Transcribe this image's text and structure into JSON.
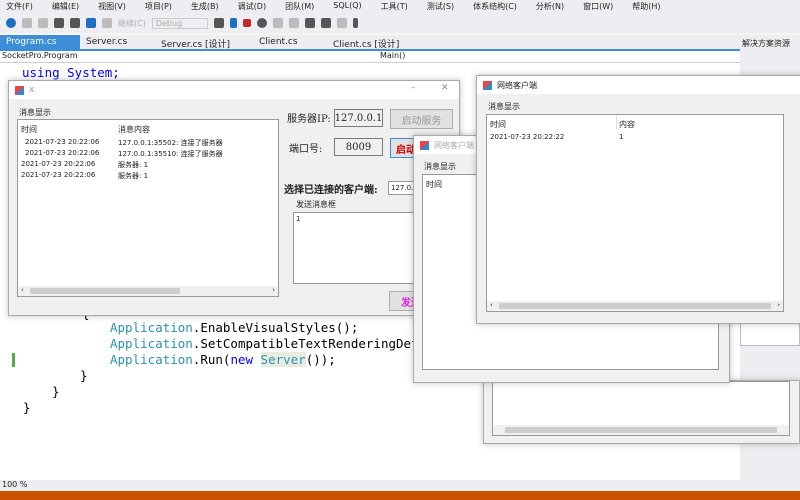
{
  "menu": [
    "文件(F)",
    "编辑(E)",
    "视图(V)",
    "项目(P)",
    "生成(B)",
    "调试(D)",
    "团队(M)",
    "SQL(Q)",
    "工具(T)",
    "测试(S)",
    "体系结构(C)",
    "分析(N)",
    "窗口(W)",
    "帮助(H)"
  ],
  "toolbar": {
    "continue": "继续(C)",
    "config": "Debug"
  },
  "tabs": [
    "Program.cs",
    "Server.cs",
    "Server.cs [设计]",
    "Client.cs",
    "Client.cs [设计]"
  ],
  "nav": {
    "left": "SocketPro.Program",
    "right": "Main()"
  },
  "side": {
    "title": "解决方案资源"
  },
  "code": {
    "l1": "using System;",
    "l2": "{",
    "l3a": "Application",
    "l3b": ".EnableVisualStyles();",
    "l4b": ".SetCompatibleTextRenderingDefa",
    "l5b": ".Run(",
    "l5new": "new",
    "l5srv": "Server",
    "l5end": "());",
    "close": "}"
  },
  "status": {
    "zoom": "100 %"
  },
  "server": {
    "title": "x",
    "group": "消息显示",
    "columns": [
      "时间",
      "消息内容"
    ],
    "rows": [
      [
        "2021-07-23 20:22:06",
        "127.0.0.1:35502: 连接了服务器"
      ],
      [
        "2021-07-23 20:22:06",
        "127.0.0.1:35510: 连接了服务器"
      ],
      [
        "2021-07-23 20:22:06",
        "服务器: 1"
      ],
      [
        "2021-07-23 20:22:06",
        "服务器: 1"
      ]
    ],
    "ip_label": "服务器IP:",
    "ip": "127.0.0.1",
    "start_disabled": "启动服务",
    "port_label": "端口号:",
    "port": "8009",
    "start": "启动",
    "client_label": "选择已连接的客户端:",
    "client": "127.0.",
    "send_group": "发送消息框",
    "send_text": "1",
    "send": "发送"
  },
  "client2": {
    "title": "网络客户端",
    "group": "消息显示",
    "columns": [
      "时间"
    ]
  },
  "client1": {
    "title": "网络客户端",
    "group": "消息显示",
    "columns": [
      "时间",
      "内容"
    ],
    "rows": [
      [
        "2021-07-23 20:22:22",
        "1"
      ]
    ]
  }
}
